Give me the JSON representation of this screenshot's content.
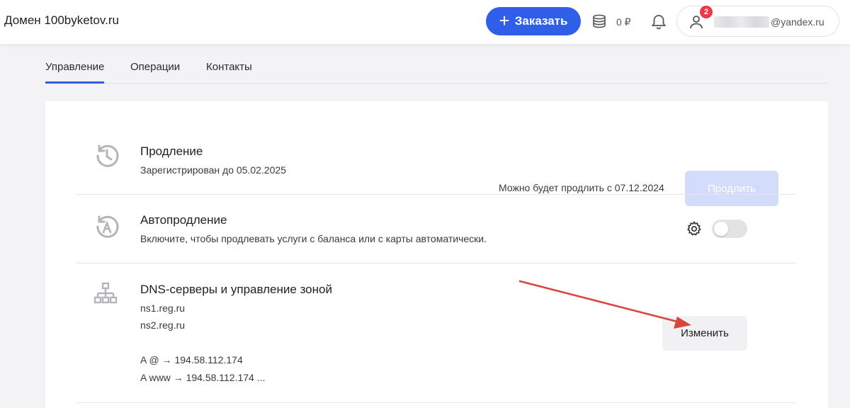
{
  "header": {
    "title": "Домен 100byketov.ru",
    "order_label": "Заказать",
    "balance": "0 ₽",
    "notifications_badge": "2",
    "email_suffix": "@yandex.ru"
  },
  "tabs": [
    {
      "label": "Управление",
      "active": true
    },
    {
      "label": "Операции",
      "active": false
    },
    {
      "label": "Контакты",
      "active": false
    }
  ],
  "renewal": {
    "title": "Продление",
    "subtitle": "Зарегистрирован до 05.02.2025",
    "note": "Можно будет продлить с 07.12.2024",
    "button_label": "Продлить"
  },
  "autorenewal": {
    "title": "Автопродление",
    "subtitle": "Включите, чтобы продлевать услуги с баланса или с карты автоматически.",
    "enabled": false
  },
  "dns": {
    "title": "DNS-серверы и управление зоной",
    "servers": [
      "ns1.reg.ru",
      "ns2.reg.ru"
    ],
    "records": [
      "A @ → 194.58.112.174",
      "A www → 194.58.112.174 ..."
    ],
    "button_label": "Изменить"
  },
  "colors": {
    "accent": "#2f5fe8",
    "annotation_arrow": "#d9453a",
    "badge": "#ea3a4a"
  },
  "icons": {
    "order": "plus-icon",
    "balance": "coins-icon",
    "notifications": "bell-icon",
    "account": "user-icon",
    "renewal": "clock-history-icon",
    "autorenewal": "auto-renew-icon",
    "dns": "sitemap-icon",
    "settings": "gear-icon"
  }
}
